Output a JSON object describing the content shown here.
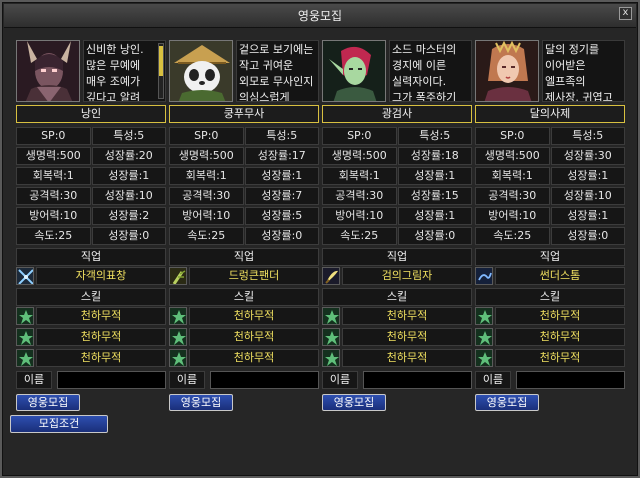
{
  "window": {
    "title": "영웅모집",
    "close_label": "x"
  },
  "heroes": [
    {
      "class_name": "낭인",
      "description": "신비한 낭인. 많은 무예에 매우 조예가 깊다고 알려",
      "sp": "SP:0",
      "trait": "특성:5",
      "hp": "생명력:500",
      "hp_growth": "성장률:20",
      "regen": "회복력:1",
      "regen_growth": "성장률:1",
      "atk": "공격력:30",
      "atk_growth": "성장률:10",
      "def": "방어력:10",
      "def_growth": "성장률:2",
      "spd": "속도:25",
      "spd_growth": "성장률:0",
      "job_label": "직업",
      "job": "자객의표창",
      "skill_label": "스킬",
      "skills": [
        "천하무적",
        "천하무적",
        "천하무적"
      ],
      "name_label": "이름",
      "recruit_label": "영웅모집"
    },
    {
      "class_name": "쿵푸무사",
      "description": "겉으로 보기에는 작고 귀여운 외모로 무사인지 의심스럽게",
      "sp": "SP:0",
      "trait": "특성:5",
      "hp": "생명력:500",
      "hp_growth": "성장률:17",
      "regen": "회복력:1",
      "regen_growth": "성장률:1",
      "atk": "공격력:30",
      "atk_growth": "성장률:7",
      "def": "방어력:10",
      "def_growth": "성장률:5",
      "spd": "속도:25",
      "spd_growth": "성장률:0",
      "job_label": "직업",
      "job": "드렁큰팬더",
      "skill_label": "스킬",
      "skills": [
        "천하무적",
        "천하무적",
        "천하무적"
      ],
      "name_label": "이름",
      "recruit_label": "영웅모집"
    },
    {
      "class_name": "광검사",
      "description": "소드 마스터의 경지에 이른 실력자이다. 그가 폭주하기 시작",
      "sp": "SP:0",
      "trait": "특성:5",
      "hp": "생명력:500",
      "hp_growth": "성장률:18",
      "regen": "회복력:1",
      "regen_growth": "성장률:1",
      "atk": "공격력:30",
      "atk_growth": "성장률:15",
      "def": "방어력:10",
      "def_growth": "성장률:1",
      "spd": "속도:25",
      "spd_growth": "성장률:0",
      "job_label": "직업",
      "job": "검의그림자",
      "skill_label": "스킬",
      "skills": [
        "천하무적",
        "천하무적",
        "천하무적"
      ],
      "name_label": "이름",
      "recruit_label": "영웅모집"
    },
    {
      "class_name": "달의사제",
      "description": "달의 정기를 이어받은 엘프족의 제사장. 귀엽고 깜찍한 외모",
      "sp": "SP:0",
      "trait": "특성:5",
      "hp": "생명력:500",
      "hp_growth": "성장률:30",
      "regen": "회복력:1",
      "regen_growth": "성장률:1",
      "atk": "공격력:30",
      "atk_growth": "성장률:10",
      "def": "방어력:10",
      "def_growth": "성장률:1",
      "spd": "속도:25",
      "spd_growth": "성장률:0",
      "job_label": "직업",
      "job": "썬더스톰",
      "skill_label": "스킬",
      "skills": [
        "천하무적",
        "천하무적",
        "천하무적"
      ],
      "name_label": "이름",
      "recruit_label": "영웅모집"
    }
  ],
  "footer": {
    "conditions_label": "모집조건"
  },
  "colors": {
    "accent_border": "#d8c040",
    "item_text": "#f0e060",
    "button_blue": "#2e4fb0"
  }
}
